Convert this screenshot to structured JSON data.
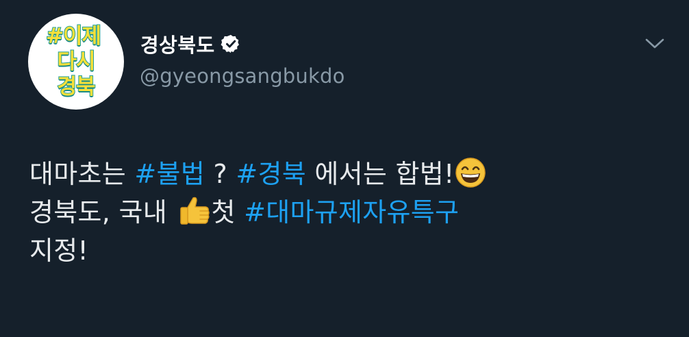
{
  "colors": {
    "background": "#15202b",
    "text": "#e7eaec",
    "secondary": "#8899a6",
    "link": "#1da1f2",
    "avatar_text": "#f6e03a",
    "avatar_outline": "#1e9f9a"
  },
  "avatar": {
    "lines": [
      "#이제",
      "다시",
      "경북"
    ]
  },
  "author": {
    "display_name": "경상북도",
    "handle": "@gyeongsangbukdo",
    "verified_icon": "verified-badge-icon"
  },
  "menu": {
    "icon": "chevron-down-icon"
  },
  "tweet": {
    "line1": {
      "t1": "대마초는 ",
      "h1": "#불법",
      "t2": " ? ",
      "h2": "#경북",
      "t3": " 에서는 합법!",
      "emoji": "grinning-face-icon"
    },
    "line2": {
      "t1": "경북도, 국내 ",
      "emoji": "thumbs-up-icon",
      "t2": "첫 ",
      "h1": "#대마규제자유특구"
    },
    "line3": {
      "t1": "지정!"
    }
  }
}
